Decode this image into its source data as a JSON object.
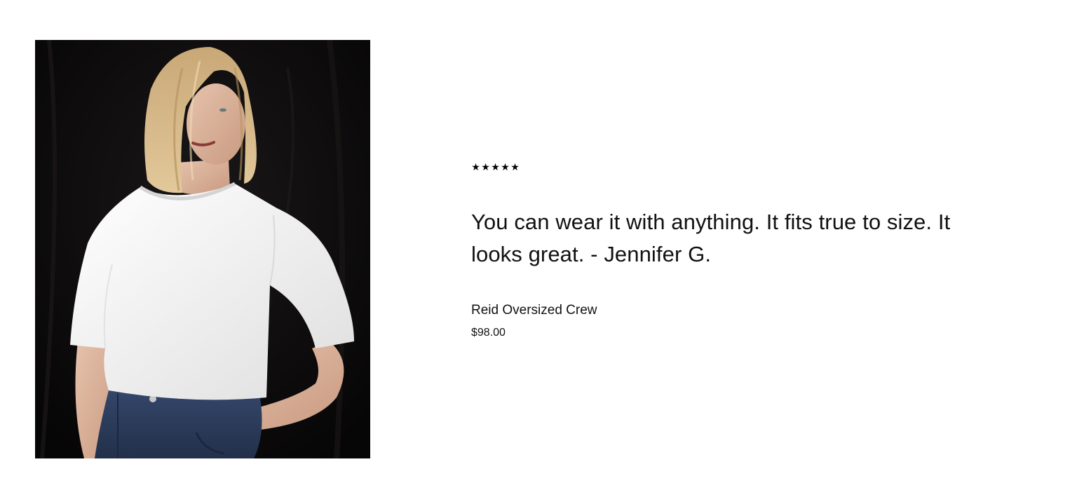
{
  "review": {
    "rating": 5,
    "rating_max": 5,
    "star_glyph": "★",
    "quote": "You can wear it with anything. It fits true to size. It looks great.",
    "separator": " - ",
    "author": "Jennifer G."
  },
  "product": {
    "name": "Reid Oversized Crew",
    "price": "$98.00",
    "image_icon": "product-photo"
  },
  "colors": {
    "background": "#ffffff",
    "text": "#111111",
    "photo_backdrop": "#0c0a0b",
    "shirt": "#f4f4f4",
    "denim": "#2a3a55"
  }
}
